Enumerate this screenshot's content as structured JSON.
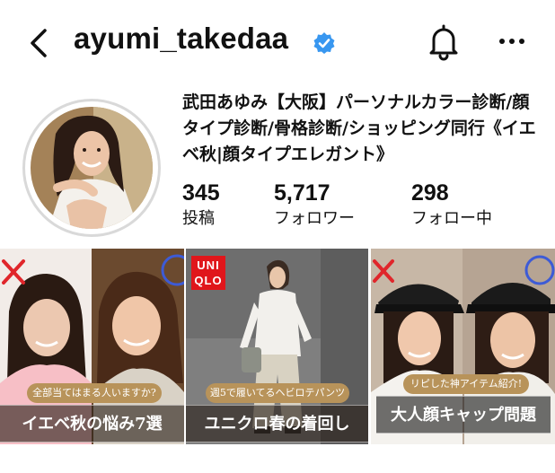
{
  "header": {
    "username": "ayumi_takedaa",
    "icons": [
      "back-chevron-icon",
      "verified-badge-icon",
      "bell-icon",
      "more-dots-icon"
    ]
  },
  "profile": {
    "bio": "武田あゆみ【大阪】パーソナルカラー診断/顔タイプ診断/骨格診断/ショッピング同行《イエベ秋|顔タイプエレガント》",
    "stats": {
      "posts": {
        "count": "345",
        "label": "投稿"
      },
      "followers": {
        "count": "5,717",
        "label": "フォロワー"
      },
      "following": {
        "count": "298",
        "label": "フォロー中"
      }
    }
  },
  "posts": [
    {
      "sub_caption": "全部当てはまる人いますか?",
      "caption": "イエベ秋の悩み7選"
    },
    {
      "logo": "UNI QLO",
      "sub_caption": "週5で履いてるヘビロテパンツ",
      "caption": "ユニクロ春の着回し"
    },
    {
      "sub_caption": "リピした神アイテム紹介!",
      "caption": "大人顔キャップ問題"
    }
  ],
  "colors": {
    "verified_blue": "#3897f0",
    "mark_red": "#e0262b",
    "mark_blue": "#3d5bd6",
    "uniqlo_red": "#e0161b",
    "caption_gold": "#b8935a"
  }
}
